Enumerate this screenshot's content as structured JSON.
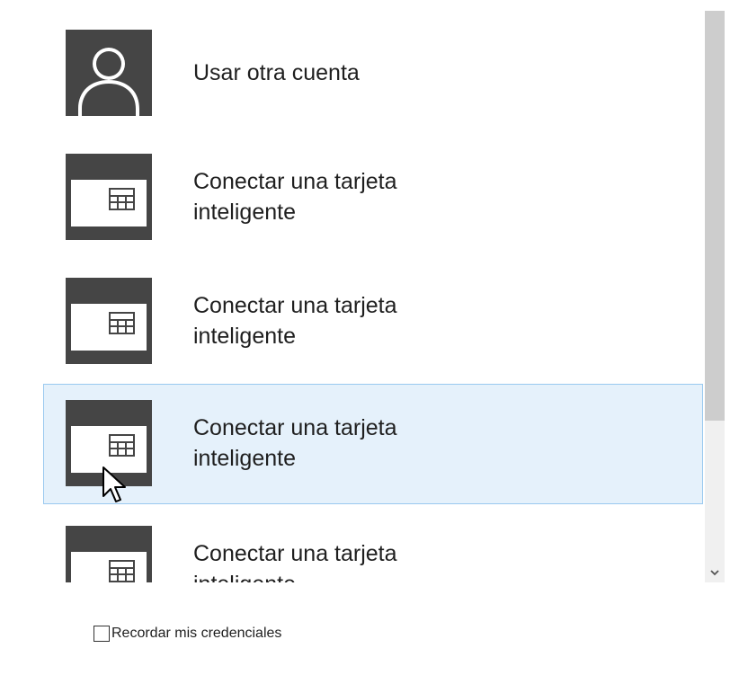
{
  "account_list": {
    "items": [
      {
        "label": "Usar otra cuenta",
        "icon": "user-silhouette-icon"
      },
      {
        "label": "Conectar una tarjeta\ninteligente",
        "icon": "smart-card-icon"
      },
      {
        "label": "Conectar una tarjeta\ninteligente",
        "icon": "smart-card-icon"
      },
      {
        "label": "Conectar una tarjeta\ninteligente",
        "icon": "smart-card-icon",
        "selected": true
      },
      {
        "label": "Conectar una tarjeta\ninteligente",
        "icon": "smart-card-icon"
      }
    ],
    "scrollbar": {
      "down_arrow_icon": "chevron-down-icon"
    }
  },
  "remember": {
    "label": "Recordar mis credenciales",
    "checked": false
  },
  "colors": {
    "tile": "#454545",
    "selection_bg": "#e5f1fb",
    "selection_border": "#99c9ef"
  }
}
